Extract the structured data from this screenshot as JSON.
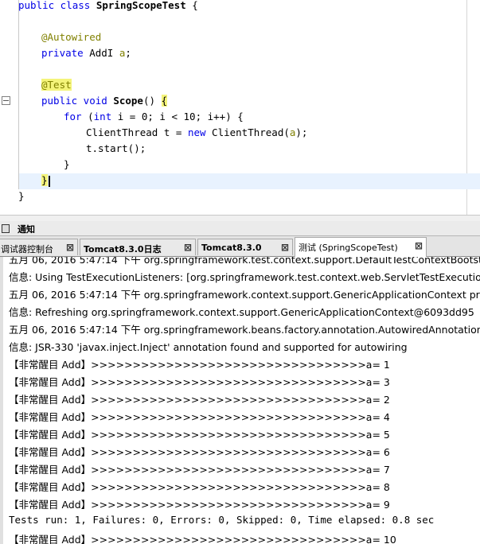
{
  "editor": {
    "line1": {
      "kw": "public class ",
      "name": "SpringScopeTest",
      "rest": " {"
    },
    "autowired": "@Autowired",
    "field_decl": {
      "kw": "private ",
      "type": "AddI ",
      "name": "a",
      "semi": ";"
    },
    "test_annotation": "@Test",
    "method": {
      "kw": "public void ",
      "name": "Scope",
      "paren": "() ",
      "brace": "{"
    },
    "for_line": {
      "kw": "for",
      "open": " (",
      "int_kw": "int",
      "rest": " i = 0; i < 10; i++) {"
    },
    "thread_line": {
      "a": "ClientThread t = ",
      "new_kw": "new",
      "b": " ClientThread(",
      "arg": "a",
      "c": ");"
    },
    "start_line": "t.start();",
    "close_for": "}",
    "close_method": "}",
    "close_class": "}"
  },
  "notice_bar": {
    "label": "通知"
  },
  "tabs": [
    {
      "label": "调试器控制台",
      "close": "⊠"
    },
    {
      "label": "Tomcat8.3.0日志",
      "close": "⊠"
    },
    {
      "label": "Tomcat8.3.0",
      "close": "⊠"
    },
    {
      "label": "测试 (SpringScopeTest)",
      "close": "⊠"
    }
  ],
  "console": {
    "lines": [
      "五月 06, 2016 5:47:14 下午 org.springframework.test.context.support.DefaultTestContextBootstrapper",
      "信息: Using TestExecutionListeners: [org.springframework.test.context.web.ServletTestExecutionListener",
      "五月 06, 2016 5:47:14 下午 org.springframework.context.support.GenericApplicationContext prepareRefresh",
      "信息: Refreshing org.springframework.context.support.GenericApplicationContext@6093dd95",
      "五月 06, 2016 5:47:14 下午 org.springframework.beans.factory.annotation.AutowiredAnnotationBeanPostProcessor",
      "信息: JSR-330 'javax.inject.Inject' annotation found and supported for autowiring",
      "【非常醒目 Add】>>>>>>>>>>>>>>>>>>>>>>>>>>>>>>>>>a= 1",
      "【非常醒目 Add】>>>>>>>>>>>>>>>>>>>>>>>>>>>>>>>>>a= 3",
      "【非常醒目 Add】>>>>>>>>>>>>>>>>>>>>>>>>>>>>>>>>>a= 2",
      "【非常醒目 Add】>>>>>>>>>>>>>>>>>>>>>>>>>>>>>>>>>a= 4",
      "【非常醒目 Add】>>>>>>>>>>>>>>>>>>>>>>>>>>>>>>>>>a= 5",
      "【非常醒目 Add】>>>>>>>>>>>>>>>>>>>>>>>>>>>>>>>>>a= 6",
      "【非常醒目 Add】>>>>>>>>>>>>>>>>>>>>>>>>>>>>>>>>>a= 7",
      "【非常醒目 Add】>>>>>>>>>>>>>>>>>>>>>>>>>>>>>>>>>a= 8",
      "【非常醒目 Add】>>>>>>>>>>>>>>>>>>>>>>>>>>>>>>>>>a= 9",
      "Tests run: 1, Failures: 0, Errors: 0, Skipped: 0, Time elapsed: 0.8 sec",
      "【非常醒目 Add】>>>>>>>>>>>>>>>>>>>>>>>>>>>>>>>>>a= 10"
    ]
  }
}
